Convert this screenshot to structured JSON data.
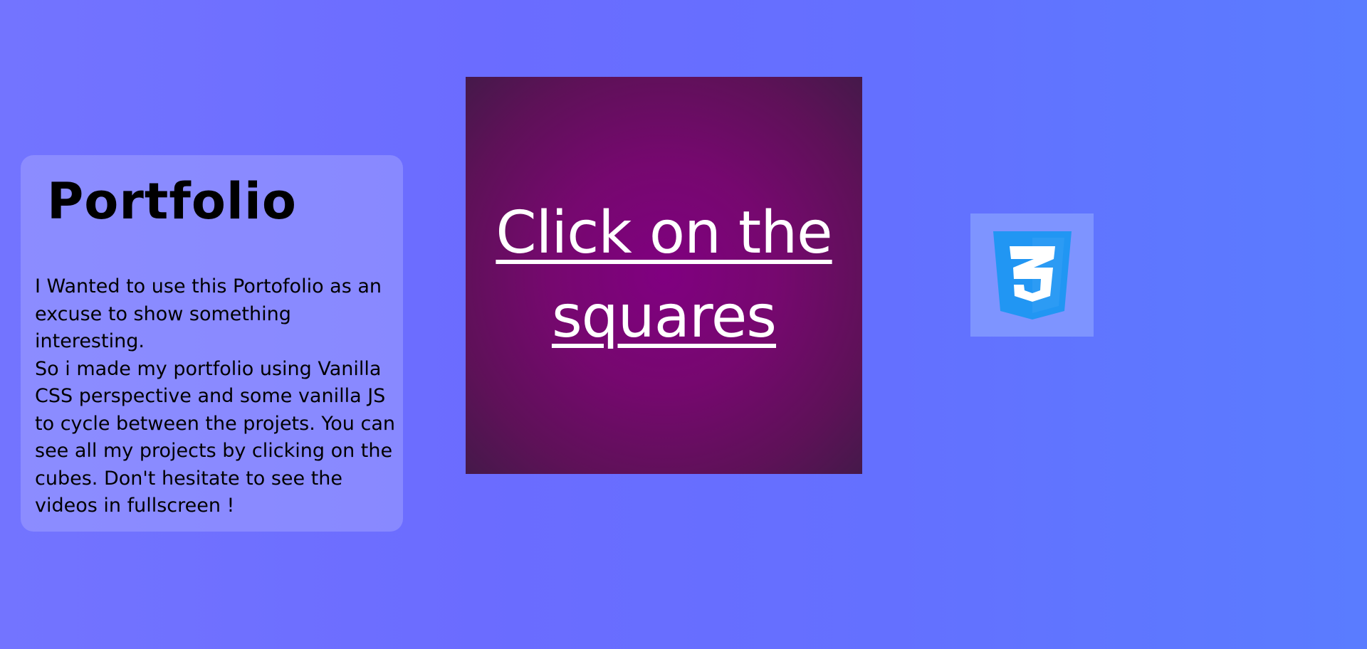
{
  "intro": {
    "title": "Portfolio",
    "description": "I Wanted to use this Portofolio as an excuse to show something interesting.\nSo i made my portfolio using Vanilla CSS perspective and some vanilla JS to cycle between the projets. You can see all my projects by clicking on the cubes. Don't hesitate to see the videos in fullscreen !"
  },
  "main_square": {
    "label": "Click on the squares"
  },
  "tech_tile": {
    "icon": "css3-icon",
    "color": "#2196f3"
  },
  "colors": {
    "background": "#6b6cff",
    "panel": "#8a8aff",
    "square": "#800080",
    "label": "#ffffff"
  }
}
